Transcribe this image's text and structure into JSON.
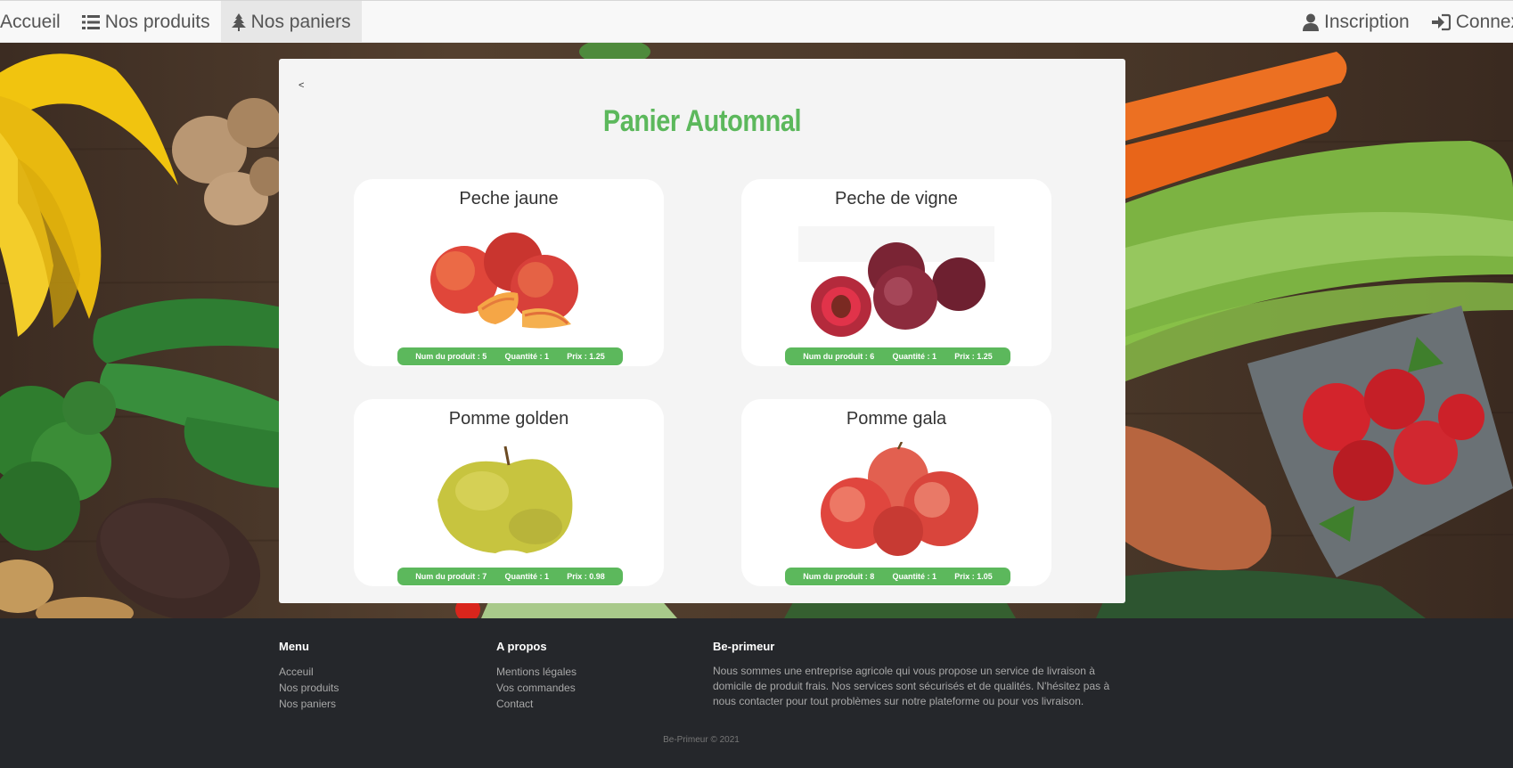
{
  "navbar": {
    "left": [
      {
        "label": "Accueil",
        "icon": "home-icon"
      },
      {
        "label": "Nos produits",
        "icon": "list-icon"
      },
      {
        "label": "Nos paniers",
        "icon": "tree-icon"
      }
    ],
    "right": [
      {
        "label": "Inscription",
        "icon": "user-icon"
      },
      {
        "label": "Connexion",
        "icon": "sign-in-icon"
      }
    ]
  },
  "panel": {
    "back": "<",
    "title": "Panier Automnal"
  },
  "products": [
    {
      "name": "Peche jaune",
      "num": "Num du produit : 5",
      "qty": "Quantité : 1",
      "price": "Prix : 1.25",
      "image": "peach-image"
    },
    {
      "name": "Peche de vigne",
      "num": "Num du produit : 6",
      "qty": "Quantité : 1",
      "price": "Prix : 1.25",
      "image": "vine-peach-image"
    },
    {
      "name": "Pomme golden",
      "num": "Num du produit : 7",
      "qty": "Quantité : 1",
      "price": "Prix : 0.98",
      "image": "golden-apple-image"
    },
    {
      "name": "Pomme gala",
      "num": "Num du produit : 8",
      "qty": "Quantité : 1",
      "price": "Prix : 1.05",
      "image": "gala-apple-image"
    }
  ],
  "footer": {
    "menu": {
      "heading": "Menu",
      "links": [
        "Acceuil",
        "Nos produits",
        "Nos paniers"
      ]
    },
    "about": {
      "heading": "A propos",
      "links": [
        "Mentions légales",
        "Vos commandes",
        "Contact"
      ]
    },
    "company": {
      "heading": "Be-primeur",
      "text": "Nous sommes une entreprise agricole qui vous propose un service de livraison à domicile de produit frais. Nos services sont sécurisés et de qualités. N'hésitez pas à nous contacter pour tout problèmes sur notre plateforme ou pour vos livraison."
    },
    "copyright": "Be-Primeur © 2021"
  },
  "colors": {
    "accent": "#5cb85c",
    "footer_bg": "#25272b",
    "navbar_bg": "#f8f8f8",
    "panel_bg": "#f4f4f4"
  }
}
